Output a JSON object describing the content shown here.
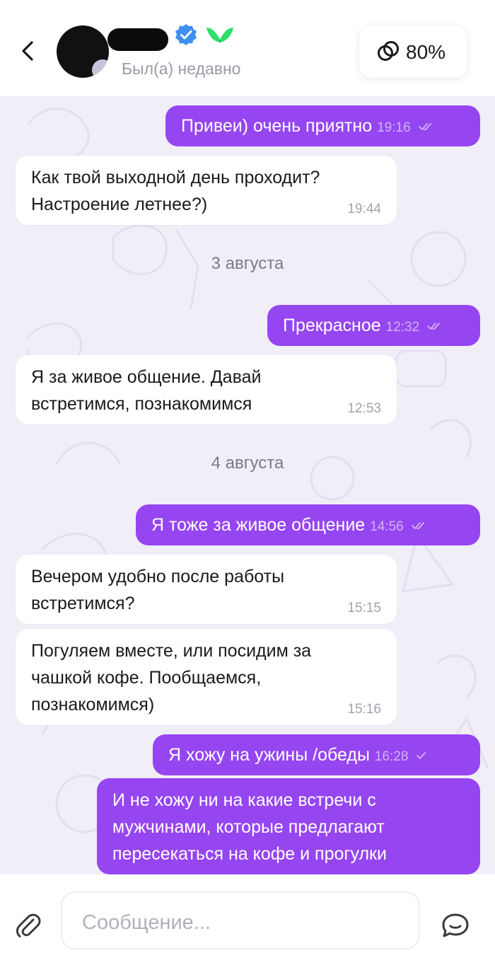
{
  "header": {
    "status": "Был(а) недавно",
    "compat_value": "80%"
  },
  "messages": [
    {
      "dir": "out",
      "text": "Привеи) очень приятно",
      "time": "19:16"
    },
    {
      "dir": "in",
      "text": "Как твой выходной день проходит? Настроение летнее?)",
      "time": "19:44"
    },
    {
      "date": "3 августа"
    },
    {
      "dir": "out",
      "text": "Прекрасное",
      "time": "12:32"
    },
    {
      "dir": "in",
      "text": "Я за живое общение. Давай встретимся, познакомимся",
      "time": "12:53"
    },
    {
      "date": "4 августа"
    },
    {
      "dir": "out",
      "text": "Я тоже за живое общение",
      "time": "14:56"
    },
    {
      "dir": "in",
      "text": "Вечером удобно после работы встретимся?",
      "time": "15:15"
    },
    {
      "dir": "in",
      "text": "Погуляем вместе, или посидим за чашкой кофе. Пообщаемся, познакомимся)",
      "time": "15:16"
    },
    {
      "dir": "out",
      "text": "Я хожу на ужины /обеды",
      "time": "16:28"
    },
    {
      "dir": "out",
      "text": "И не хожу ни на какие встречи с мужчинами, которые предлагают пересекаться на кофе и прогулки"
    }
  ],
  "composer": {
    "placeholder": "Сообщение..."
  },
  "colors": {
    "outgoing": "#9646f0",
    "incoming": "#ffffff",
    "background": "#f1eef8",
    "verified": "#3f8ff0",
    "brand": "#2ee06a"
  },
  "icons": {
    "back": "chevron-left-icon",
    "verified": "verified-badge-icon",
    "brand": "butterfly-logo-icon",
    "compat": "rings-icon",
    "attach": "paperclip-icon",
    "chat": "chat-bubble-icon",
    "read": "double-check-icon",
    "sent": "check-icon"
  }
}
